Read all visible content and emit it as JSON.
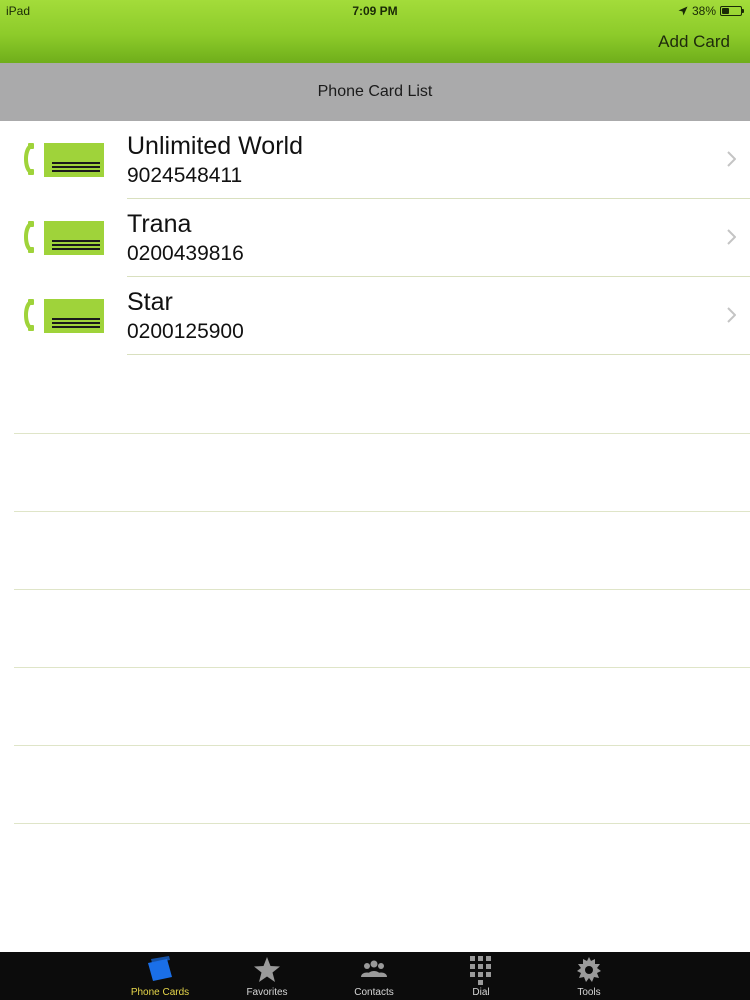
{
  "status_bar": {
    "carrier": "iPad",
    "time": "7:09 PM",
    "battery": "38%",
    "battery_level": 0.38
  },
  "nav": {
    "add_card_label": "Add Card"
  },
  "section": {
    "title": "Phone Card List"
  },
  "cards": [
    {
      "name": "Unlimited World",
      "number": "9024548411",
      "icon": "phone-card-icon"
    },
    {
      "name": "Trana",
      "number": "0200439816",
      "icon": "phone-card-icon"
    },
    {
      "name": "Star",
      "number": "0200125900",
      "icon": "phone-card-icon"
    }
  ],
  "tabs": [
    {
      "label": "Phone Cards",
      "icon": "phone-cards-icon",
      "active": true
    },
    {
      "label": "Favorites",
      "icon": "star-icon",
      "active": false
    },
    {
      "label": "Contacts",
      "icon": "contacts-icon",
      "active": false
    },
    {
      "label": "Dial",
      "icon": "keypad-icon",
      "active": false
    },
    {
      "label": "Tools",
      "icon": "gear-icon",
      "active": false
    }
  ],
  "colors": {
    "nav_green": "#8dcb2a",
    "header_gray": "#aaaaab",
    "card_icon_green": "#9fd33a",
    "active_tab_label": "#e6d64a",
    "active_tab_icon": "#1a6fe8"
  }
}
